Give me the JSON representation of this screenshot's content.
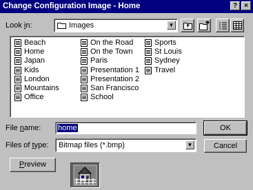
{
  "dialog": {
    "title": "Change Configuration Image - Home",
    "help_button": "?",
    "close_button": "×"
  },
  "look_in": {
    "label_prefix": "Look ",
    "label_accel": "i",
    "label_suffix": "n:",
    "value": "Images"
  },
  "toolbar": {
    "up_folder_icon": "up-folder-icon",
    "new_folder_icon": "new-folder-icon",
    "list_view_icon": "list-view-icon",
    "details_view_icon": "details-view-icon"
  },
  "files": [
    [
      "Beach",
      "Home",
      "Japan",
      "Kids",
      "London",
      "Mountains",
      "Office"
    ],
    [
      "On the Road",
      "On the Town",
      "Paris",
      "Presentation 1",
      "Presentation 2",
      "San Francisco",
      "School"
    ],
    [
      "Sports",
      "St Louis",
      "Sydney",
      "Travel"
    ]
  ],
  "file_name": {
    "label_prefix": "File ",
    "label_accel": "n",
    "label_suffix": "ame:",
    "value": "home"
  },
  "file_type": {
    "label_prefix": "Files of ",
    "label_accel": "t",
    "label_suffix": "ype:",
    "value": "Bitmap files (*.bmp)"
  },
  "buttons": {
    "ok": "OK",
    "cancel": "Cancel",
    "preview_accel": "P",
    "preview_rest": "review"
  },
  "colors": {
    "title_bar": "#000080",
    "dialog_bg": "#c0c0c0",
    "selection": "#000080"
  }
}
